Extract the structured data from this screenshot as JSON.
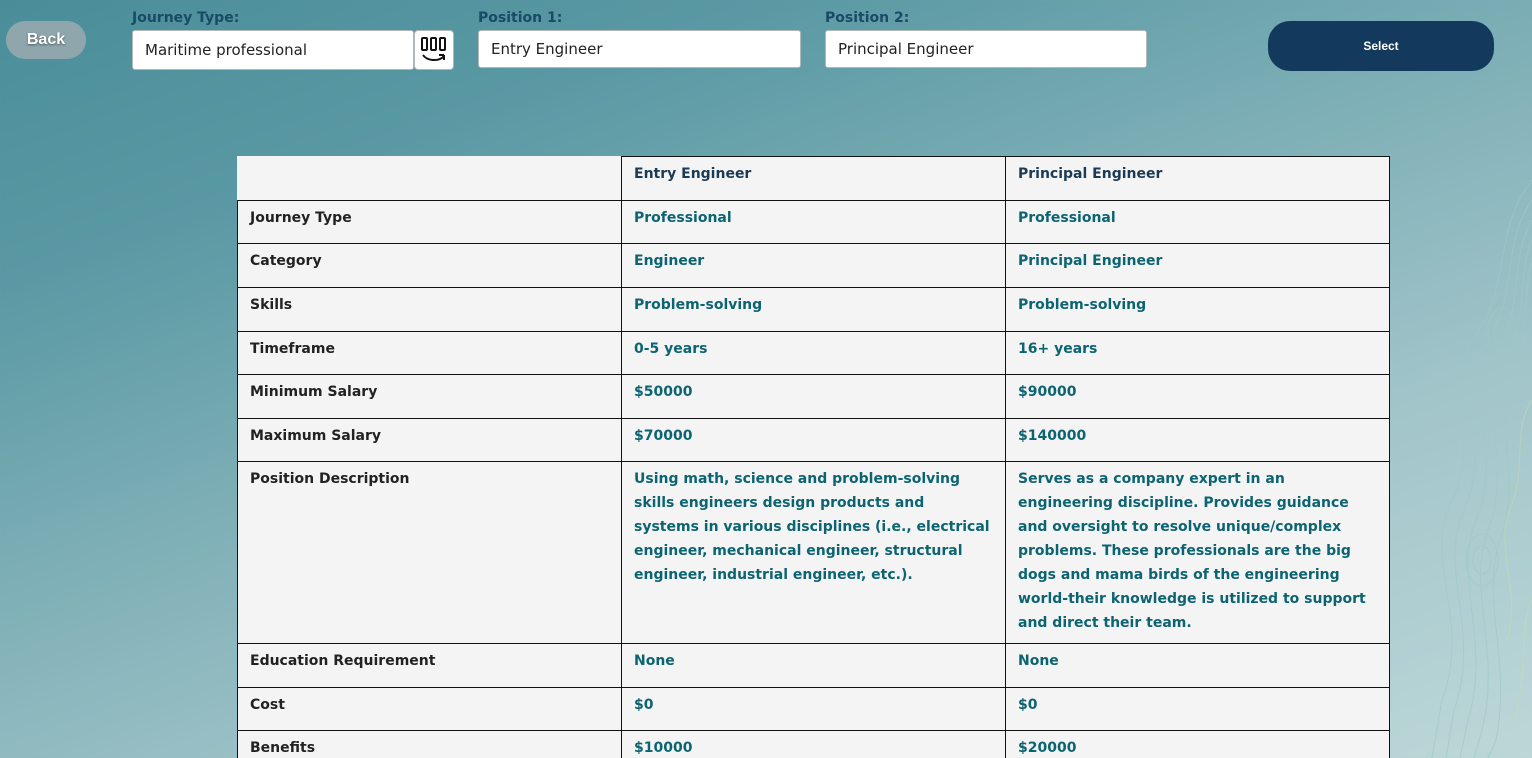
{
  "back_label": "Back",
  "journey_type": {
    "label": "Journey Type:",
    "value": "Maritime professional"
  },
  "position1": {
    "label": "Position 1:",
    "value": "Entry Engineer"
  },
  "position2": {
    "label": "Position 2:",
    "value": "Principal Engineer"
  },
  "select_label": "Select",
  "table": {
    "columns": [
      "Entry Engineer",
      "Principal Engineer"
    ],
    "rows": [
      {
        "label": "Journey Type",
        "v1": "Professional",
        "v2": "Professional"
      },
      {
        "label": "Category",
        "v1": "Engineer",
        "v2": "Principal Engineer"
      },
      {
        "label": "Skills",
        "v1": "Problem-solving",
        "v2": "Problem-solving"
      },
      {
        "label": "Timeframe",
        "v1": "0-5 years",
        "v2": "16+ years"
      },
      {
        "label": "Minimum Salary",
        "v1": "$50000",
        "v2": "$90000"
      },
      {
        "label": "Maximum Salary",
        "v1": "$70000",
        "v2": "$140000"
      },
      {
        "label": "Position Description",
        "v1": "Using math, science and problem-solving skills engineers design products and systems in various disciplines (i.e., electrical engineer, mechanical engineer, structural engineer, industrial engineer, etc.).",
        "v2": "Serves as a company expert in an engineering discipline. Provides guidance and oversight to resolve unique/complex problems. These professionals are the big dogs and mama birds of the engineering world-their knowledge is utilized to support and direct their team."
      },
      {
        "label": "Education Requirement",
        "v1": "None",
        "v2": "None"
      },
      {
        "label": "Cost",
        "v1": "$0",
        "v2": "$0"
      },
      {
        "label": "Benefits",
        "v1": "$10000",
        "v2": "$20000"
      }
    ]
  },
  "colors": {
    "primary_button": "#133a5c",
    "label_text": "#1a4a66",
    "value_text": "#0c6472"
  },
  "icons": [
    "barcode-scan-icon"
  ]
}
